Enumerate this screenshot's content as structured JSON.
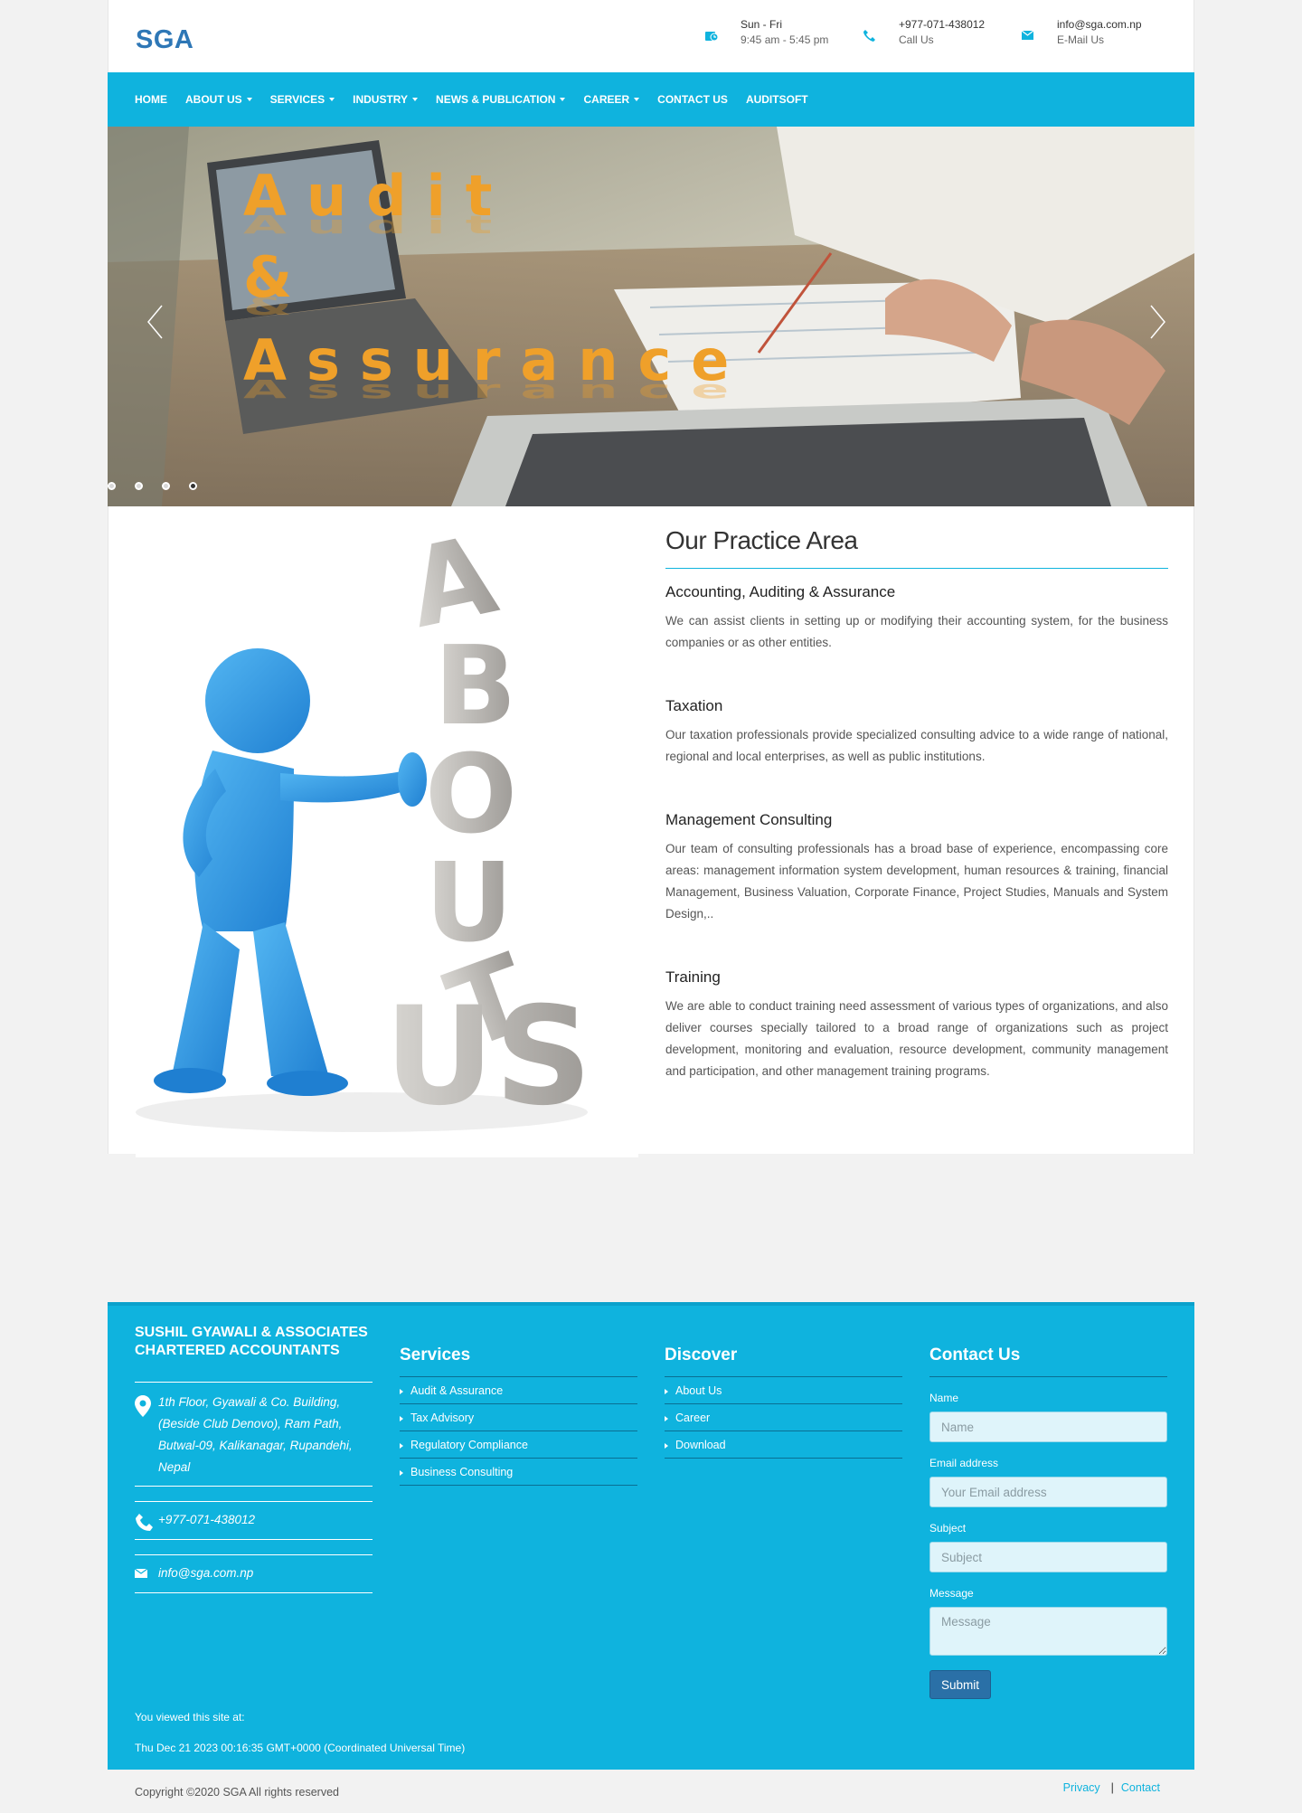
{
  "header": {
    "logo": "SGA",
    "hours": {
      "title": "Sun - Fri",
      "sub": "9:45 am - 5:45 pm"
    },
    "phone": {
      "title": "+977-071-438012",
      "sub": "Call Us"
    },
    "email": {
      "title": "info@sga.com.np",
      "sub": "E-Mail Us"
    }
  },
  "nav": {
    "items": [
      {
        "label": "HOME"
      },
      {
        "label": "ABOUT US"
      },
      {
        "label": "SERVICES"
      },
      {
        "label": "INDUSTRY"
      },
      {
        "label": "NEWS & PUBLICATION"
      },
      {
        "label": "CAREER"
      },
      {
        "label": "CONTACT US"
      },
      {
        "label": "AUDITSOFT"
      }
    ]
  },
  "hero": {
    "line1": "Audit",
    "line2": "&",
    "line3": "Assurance",
    "slide_count": 4,
    "active_slide": 4
  },
  "practice": {
    "title": "Our Practice Area",
    "items": [
      {
        "heading": "Accounting, Auditing & Assurance",
        "text": "We can assist clients in setting up or modifying their accounting system, for the business companies or as other entities."
      },
      {
        "heading": "Taxation",
        "text": "Our taxation professionals provide specialized consulting advice to a wide range of national, regional and local enterprises, as well as public institutions."
      },
      {
        "heading": "Management Consulting",
        "text": "Our team of consulting professionals has a broad base of experience, encompassing core areas: management information system development, human resources & training, financial Management, Business Valuation, Corporate Finance, Project Studies, Manuals and System Design,.."
      },
      {
        "heading": "Training",
        "text": "We are able to conduct training need assessment of various types of organizations, and also deliver courses specially tailored to a broad range of organizations such as project development, monitoring and evaluation, resource development, community management and participation, and other management training programs."
      }
    ]
  },
  "footer": {
    "company_line1": "SUSHIL GYAWALI & ASSOCIATES",
    "company_line2": "CHARTERED ACCOUNTANTS",
    "address": "1th Floor, Gyawali & Co. Building, (Beside Club Denovo), Ram Path, Butwal-09, Kalikanagar, Rupandehi, Nepal",
    "phone": "+977-071-438012",
    "email": "info@sga.com.np",
    "services_title": "Services",
    "services": [
      "Audit & Assurance",
      "Tax Advisory",
      "Regulatory Compliance",
      "Business Consulting"
    ],
    "discover_title": "Discover",
    "discover": [
      "About Us",
      "Career",
      "Download"
    ],
    "contact_title": "Contact Us",
    "form": {
      "name_label": "Name",
      "name_placeholder": "Name",
      "email_label": "Email address",
      "email_placeholder": "Your Email address",
      "subject_label": "Subject",
      "subject_placeholder": "Subject",
      "message_label": "Message",
      "message_placeholder": "Message",
      "submit": "Submit"
    },
    "viewed_label": "You viewed this site at:",
    "viewed_time": "Thu Dec 21 2023 00:16:35 GMT+0000 (Coordinated Universal Time)"
  },
  "copyright": {
    "text": "Copyright ©2020 SGA All rights reserved",
    "privacy": "Privacy",
    "contact": "Contact"
  },
  "colors": {
    "accent": "#0fb3de",
    "logo": "#2e77b6",
    "hero_text": "#efa02a",
    "submit": "#2a70a7"
  }
}
